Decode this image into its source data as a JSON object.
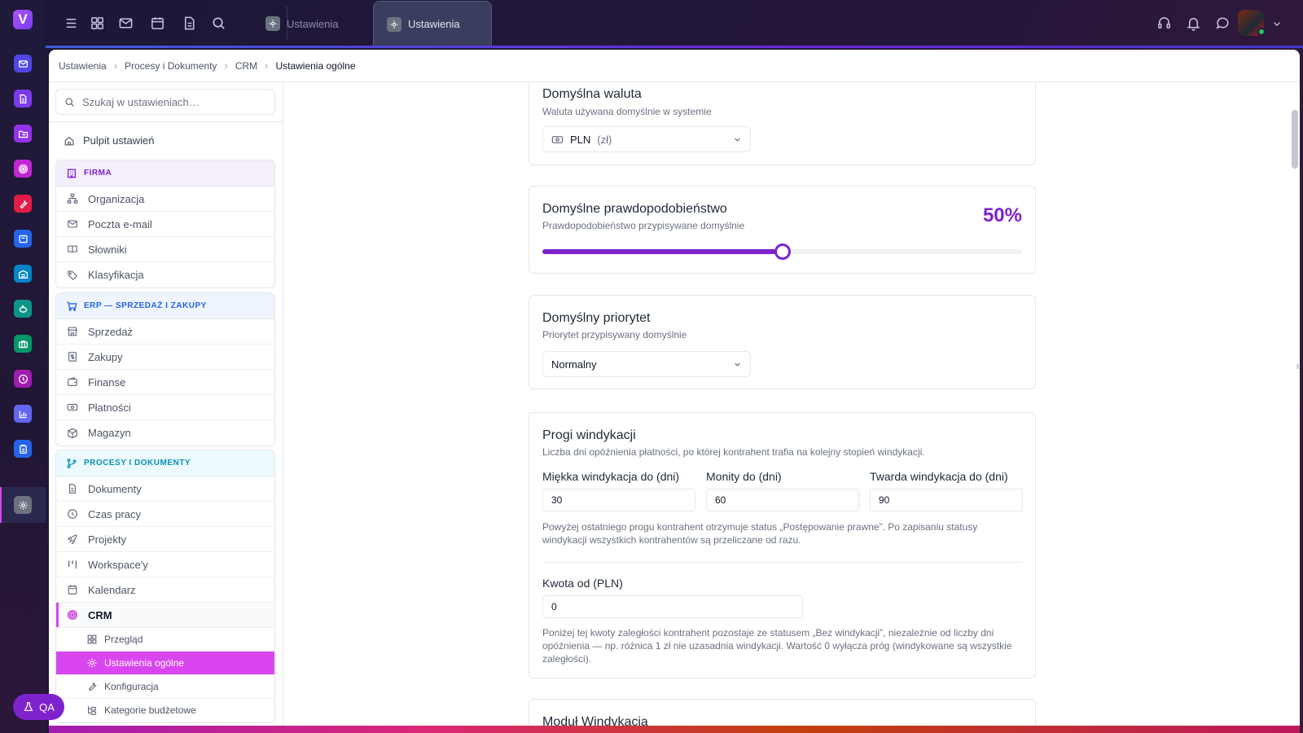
{
  "topbar": {
    "tabs": [
      {
        "label": "Ustawienia"
      },
      {
        "label": "Ustawienia"
      }
    ]
  },
  "breadcrumb": [
    "Ustawienia",
    "Procesy i Dokumenty",
    "CRM",
    "Ustawienia ogólne"
  ],
  "sidebar": {
    "search_placeholder": "Szukaj w ustawieniach…",
    "home": "Pulpit ustawień",
    "groups": [
      {
        "title": "FIRMA",
        "color": "#7e22ce",
        "bg": "#f5eefb",
        "items": [
          "Organizacja",
          "Poczta e-mail",
          "Słowniki",
          "Klasyfikacja"
        ]
      },
      {
        "title": "ERP — SPRZEDAŻ I ZAKUPY",
        "color": "#2563eb",
        "bg": "#eff5fe",
        "items": [
          "Sprzedaż",
          "Zakupy",
          "Finanse",
          "Płatności",
          "Magazyn"
        ]
      },
      {
        "title": "PROCESY I DOKUMENTY",
        "color": "#0891b2",
        "bg": "#ecfaff",
        "items": [
          "Dokumenty",
          "Czas pracy",
          "Projekty",
          "Workspace'y",
          "Kalendarz",
          "CRM"
        ],
        "subitems": [
          "Przegląd",
          "Ustawienia ogólne",
          "Konfiguracja",
          "Kategorie budżetowe"
        ]
      }
    ]
  },
  "settings": {
    "currency": {
      "title": "Domyślna waluta",
      "desc": "Waluta używana domyślnie w systemie",
      "value": "PLN",
      "symbol": "(zł)"
    },
    "probability": {
      "title": "Domyślne prawdopodobieństwo",
      "desc": "Prawdopodobieństwo przypisywane domyślnie",
      "display": "50%",
      "value": 0.5
    },
    "priority": {
      "title": "Domyślny priorytet",
      "desc": "Priorytet przypisywany domyślnie",
      "value": "Normalny"
    },
    "collection": {
      "title": "Progi windykacji",
      "desc": "Liczba dni opóźnienia płatności, po której kontrahent trafia na kolejny stopień windykacji.",
      "soft_label": "Miękka windykacja do (dni)",
      "soft_value": "30",
      "reminders_label": "Monity do (dni)",
      "reminders_value": "60",
      "hard_label": "Twarda windykacja do (dni)",
      "hard_value": "90",
      "note1": "Powyżej ostatniego progu kontrahent otrzymuje status „Postępowanie prawne”. Po zapisaniu statusy windykacji wszystkich kontrahentów są przeliczane od razu.",
      "amount_label": "Kwota od (PLN)",
      "amount_value": "0",
      "note2": "Poniżej tej kwoty zaległości kontrahent pozostaje ze statusem „Bez windykacji”, niezależnie od liczby dni opóźnienia — np. różnica 1 zł nie uzasadnia windykacji. Wartość 0 wyłącza próg (windykowane są wszystkie zaległości)."
    },
    "module": {
      "title": "Moduł Windykacja"
    }
  },
  "qa_label": "QA",
  "rail_icons": [
    "mail-icon",
    "document-icon",
    "folder-share-icon",
    "target-icon",
    "tool-icon",
    "box-icon",
    "warehouse-icon",
    "piggy-bank-icon",
    "briefcase-icon",
    "clock-icon",
    "chart-icon",
    "clipboard-icon",
    "settings-icon"
  ]
}
